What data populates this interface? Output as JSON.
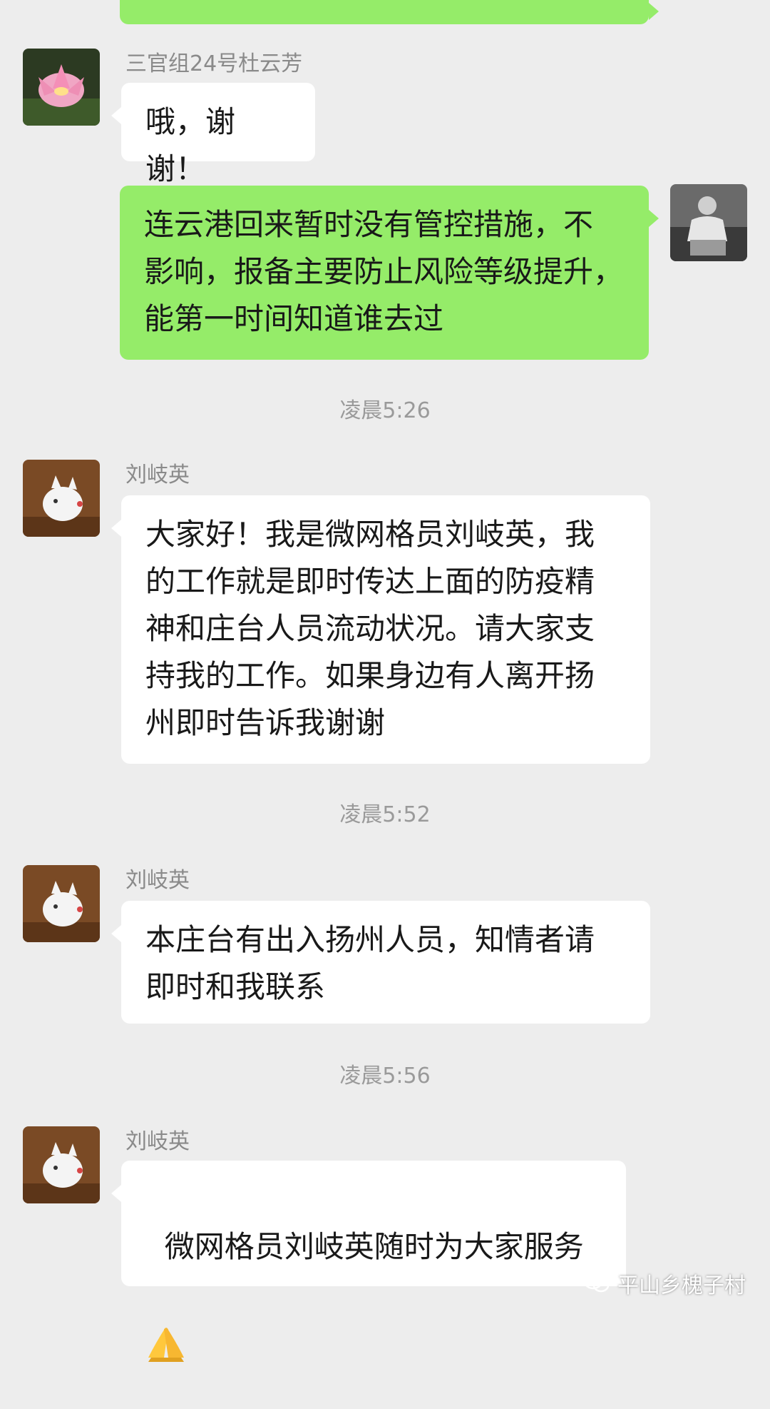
{
  "messages": [
    {
      "sender": "",
      "text": "",
      "side": "me"
    },
    {
      "sender": "三官组24号杜云芳",
      "text": "哦，谢谢！",
      "side": "left",
      "avatar": "lotus-avatar"
    },
    {
      "sender": "",
      "text": "连云港回来暂时没有管控措施，不\n影响，报备主要防止风险等级提升，\n能第一时间知道谁去过",
      "side": "me",
      "avatar": "photo-avatar"
    },
    {
      "sender": "刘岐英",
      "text": "大家好！我是微网格员刘岐英，我\n的工作就是即时传达上面的防疫精\n神和庄台人员流动状况。请大家支\n持我的工作。如果身边有人离开扬\n州即时告诉我谢谢",
      "side": "left",
      "avatar": "piggy-avatar"
    },
    {
      "sender": "刘岐英",
      "text": "本庄台有出入扬州人员，知情者请\n即时和我联系",
      "side": "left",
      "avatar": "piggy-avatar"
    },
    {
      "sender": "刘岐英",
      "text": "微网格员刘岐英随时为大家服务",
      "side": "left",
      "avatar": "piggy-avatar",
      "emoji": "folded-hands-emoji"
    }
  ],
  "timestamps": [
    "凌晨5:26",
    "凌晨5:52",
    "凌晨5:56"
  ],
  "watermark": {
    "text": "平山乡槐子村",
    "icon": "wechat-icon"
  },
  "colors": {
    "background": "#ededed",
    "my_bubble": "#95ec69",
    "other_bubble": "#ffffff"
  }
}
